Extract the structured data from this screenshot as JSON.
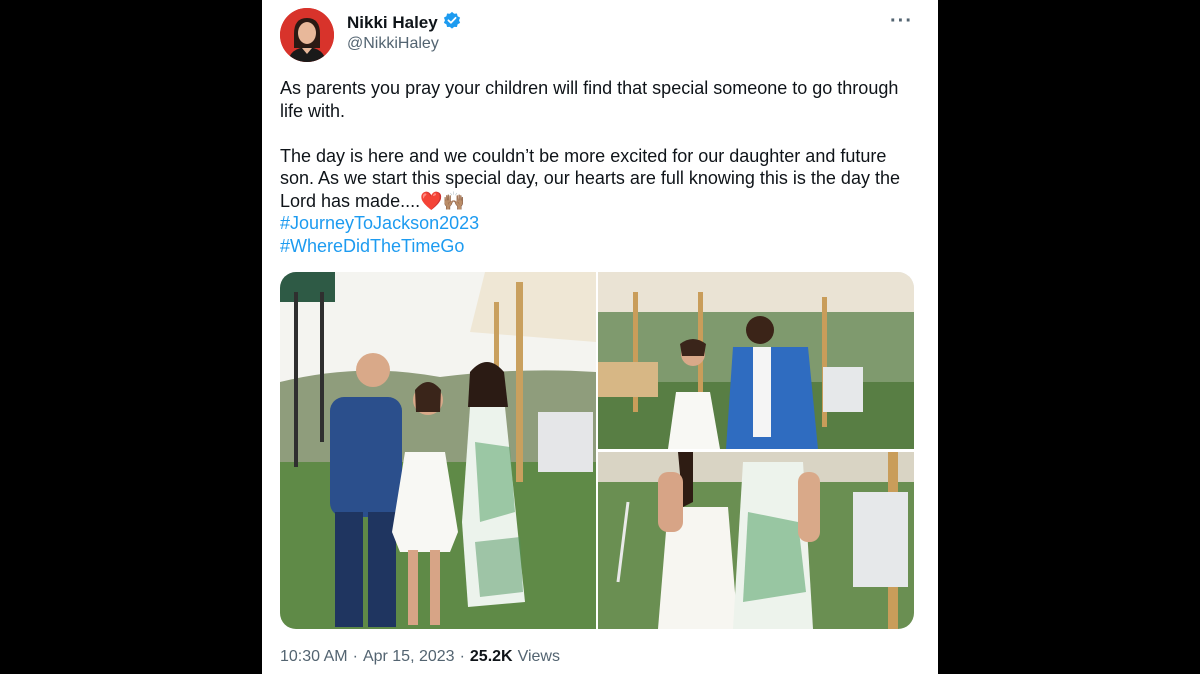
{
  "tweet": {
    "author_name": "Nikki Haley",
    "author_handle": "@NikkiHaley",
    "verified": true,
    "more_icon": "more-icon",
    "text_p1": "As parents you pray your children will find that special someone to go through life with.",
    "text_p2": "The day is here and we couldn’t be more excited for our daughter and future son. As we start this special day, our hearts are full knowing this is the day the Lord has made....",
    "emoji": "❤️🙌🏽",
    "hashtags": [
      "#JourneyToJackson2023",
      "#WhereDidTheTimeGo"
    ],
    "time": "10:30 AM",
    "sep": "·",
    "date": "Apr 15, 2023",
    "views_count": "25.2K",
    "views_label": "Views"
  },
  "colors": {
    "link": "#1d9bf0",
    "verified": "#1d9bf0",
    "avatar_bg": "#d8332b"
  }
}
